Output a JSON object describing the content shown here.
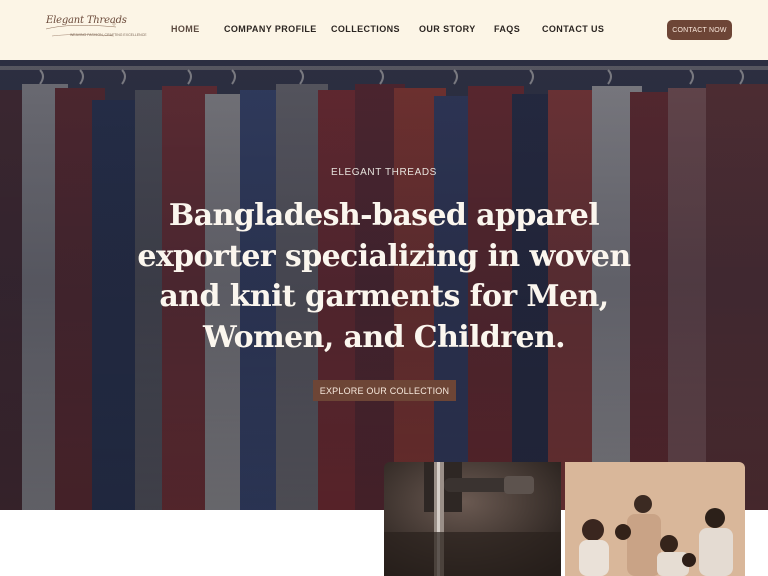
{
  "brand": {
    "logo_script": "Elegant Threads",
    "logo_tagline": "WEAVING FASHION, CRAFTING EXCELLENCE",
    "accent_color": "#6d4536",
    "header_bg": "#fcf5e6"
  },
  "nav": {
    "items": [
      {
        "label": "HOME",
        "active": true
      },
      {
        "label": "COMPANY PROFILE",
        "active": false
      },
      {
        "label": "COLLECTIONS",
        "active": false
      },
      {
        "label": "OUR STORY",
        "active": false
      },
      {
        "label": "FAQS",
        "active": false
      },
      {
        "label": "CONTACT US",
        "active": false
      }
    ],
    "contact_button": "CONTACT NOW"
  },
  "hero": {
    "eyebrow": "ELEGANT THREADS",
    "headline": "Bangladesh-based apparel exporter specializing in woven and knit garments for Men, Women, and Children.",
    "cta": "EXPLORE OUR COLLECTION",
    "background_image": "clothing-rack-photo"
  },
  "gallery": {
    "left_image": "sewing-machine-photo",
    "right_image": "family-group-photo"
  }
}
